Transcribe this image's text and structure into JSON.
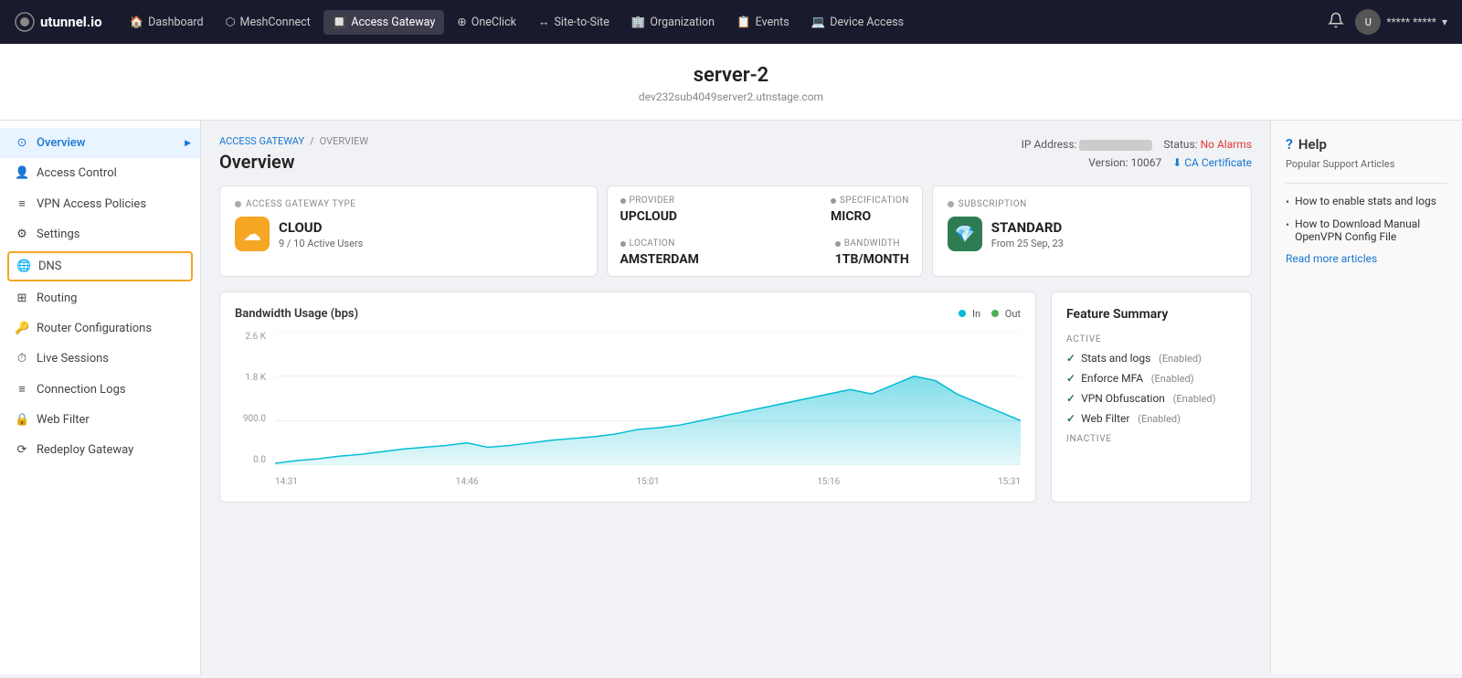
{
  "brand": {
    "name": "utunnel.io"
  },
  "topnav": {
    "items": [
      {
        "id": "dashboard",
        "label": "Dashboard",
        "icon": "🏠",
        "active": false
      },
      {
        "id": "meshconnect",
        "label": "MeshConnect",
        "icon": "⬡",
        "active": false
      },
      {
        "id": "access-gateway",
        "label": "Access Gateway",
        "icon": "🔲",
        "active": true
      },
      {
        "id": "oneclick",
        "label": "OneClick",
        "icon": "⊕",
        "active": false
      },
      {
        "id": "site-to-site",
        "label": "Site-to-Site",
        "icon": "↔",
        "active": false
      },
      {
        "id": "organization",
        "label": "Organization",
        "icon": "🏢",
        "active": false
      },
      {
        "id": "events",
        "label": "Events",
        "icon": "📋",
        "active": false
      },
      {
        "id": "device-access",
        "label": "Device Access",
        "icon": "💻",
        "active": false
      }
    ],
    "user_name": "***** *****"
  },
  "page_title": "server-2",
  "page_subtitle": "dev232sub4049server2.utnstage.com",
  "breadcrumb": {
    "parent": "ACCESS GATEWAY",
    "current": "OVERVIEW"
  },
  "overview": {
    "title": "Overview",
    "ip_label": "IP Address:",
    "status_label": "Status:",
    "status_value": "No Alarms",
    "version_label": "Version:",
    "version_value": "10067",
    "ca_cert_label": "CA Certificate"
  },
  "gateway_type_card": {
    "label": "ACCESS GATEWAY TYPE",
    "type": "CLOUD",
    "active_users": "9 / 10 Active Users"
  },
  "provider_card": {
    "provider_label": "PROVIDER",
    "provider_value": "UPCLOUD",
    "specification_label": "SPECIFICATION",
    "specification_value": "MICRO",
    "location_label": "LOCATION",
    "location_value": "AMSTERDAM",
    "bandwidth_label": "BANDWIDTH",
    "bandwidth_value": "1TB/MONTH"
  },
  "subscription_card": {
    "label": "SUBSCRIPTION",
    "tier": "STANDARD",
    "from_date": "From 25 Sep, 23"
  },
  "bandwidth_chart": {
    "title": "Bandwidth Usage (bps)",
    "legend_in": "In",
    "legend_out": "Out",
    "y_labels": [
      "2.6 K",
      "1.8 K",
      "900.0",
      "0.0"
    ],
    "x_labels": [
      "14:31",
      "14:46",
      "15:01",
      "15:16",
      "15:31"
    ],
    "colors": {
      "in": "#00bcd4",
      "out": "#4caf50"
    }
  },
  "feature_summary": {
    "title": "Feature Summary",
    "active_label": "ACTIVE",
    "features_active": [
      {
        "name": "Stats and logs",
        "status": "Enabled"
      },
      {
        "name": "Enforce MFA",
        "status": "Enabled"
      },
      {
        "name": "VPN Obfuscation",
        "status": "Enabled"
      },
      {
        "name": "Web Filter",
        "status": "Enabled"
      }
    ],
    "inactive_label": "INACTIVE"
  },
  "help_panel": {
    "title": "Help",
    "subtitle": "Popular Support Articles",
    "articles": [
      "How to enable stats and logs",
      "How to Download Manual OpenVPN Config File"
    ],
    "read_more": "Read more articles"
  },
  "sidebar": {
    "items": [
      {
        "id": "overview",
        "label": "Overview",
        "icon": "⊙",
        "active": true
      },
      {
        "id": "access-control",
        "label": "Access Control",
        "icon": "👤",
        "active": false
      },
      {
        "id": "vpn-access-policies",
        "label": "VPN Access Policies",
        "icon": "≡",
        "active": false
      },
      {
        "id": "settings",
        "label": "Settings",
        "icon": "⚙",
        "active": false
      },
      {
        "id": "dns",
        "label": "DNS",
        "icon": "🌐",
        "active": false,
        "highlighted": true
      },
      {
        "id": "routing",
        "label": "Routing",
        "icon": "⊞",
        "active": false
      },
      {
        "id": "router-configurations",
        "label": "Router Configurations",
        "icon": "🔑",
        "active": false
      },
      {
        "id": "live-sessions",
        "label": "Live Sessions",
        "icon": "⏱",
        "active": false
      },
      {
        "id": "connection-logs",
        "label": "Connection Logs",
        "icon": "≡",
        "active": false
      },
      {
        "id": "web-filter",
        "label": "Web Filter",
        "icon": "🔒",
        "active": false
      },
      {
        "id": "redeploy-gateway",
        "label": "Redeploy Gateway",
        "icon": "⟳",
        "active": false
      }
    ]
  }
}
